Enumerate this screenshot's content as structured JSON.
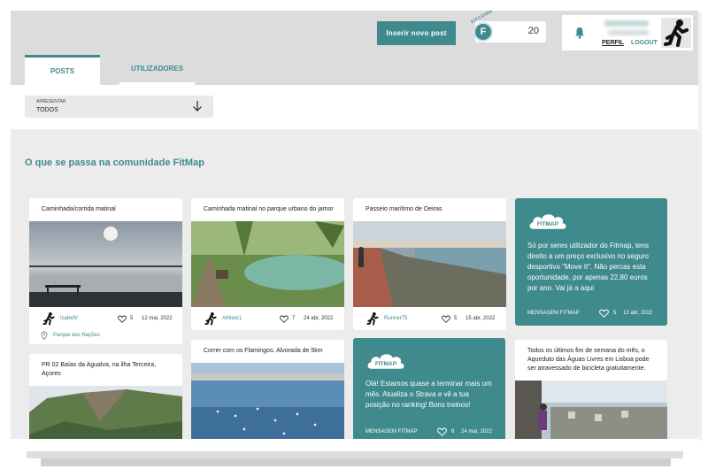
{
  "header": {
    "new_post_label": "Inserir novo post",
    "coins_label": "FITCOINS",
    "coin_letter": "F",
    "coins_value": "20",
    "profile_link": "PERFIL",
    "logout_link": "LOGOUT"
  },
  "tabs": [
    {
      "label": "POSTS",
      "active": true
    },
    {
      "label": "UTILIZADORES",
      "active": false
    }
  ],
  "filter": {
    "label": "APRESENTAR",
    "value": "TODOS"
  },
  "section_title": "O que se passa na comunidade FitMap",
  "posts": [
    {
      "title": "Caminhada/corrida matinal",
      "user": "IsabelV",
      "likes": "5",
      "date": "12 mai, 2022",
      "location": "Parque das Nações"
    },
    {
      "title": "Caminhada matinal no parque urbano do jamor",
      "user": "Athlete1",
      "likes": "7",
      "date": "24 abr, 2022"
    },
    {
      "title": "Passeio marítimo de Oeiras",
      "user": "Runner75",
      "likes": "5",
      "date": "15 abr, 2022"
    },
    {
      "title": "PR 02 Baías da Agualva, na ilha Terceira, Açores"
    },
    {
      "title": "Correr com os Flamingos. Alvorada de 5km"
    },
    {
      "title": "Todos os últimos fim de semana do mês, o Aqueduto das Águas Livres em Lisboa pode ser atravessado de bicicleta gratuitamente."
    }
  ],
  "messages": [
    {
      "text": "Só por seres utilizador do Fitmap, tens direito a um preço exclusivo no seguro desportivo \"Move It\". Não percas esta oportunidade, por apenas 22,80 euros por ano. Vai já a aqui",
      "label": "MENSAGEM FITMAP",
      "likes": "5",
      "date": "12 abr, 2022"
    },
    {
      "text": "Olá! Estamos quase a terminar mais um mês. Atualiza o Strava e vê a tua posição no ranking! Bons treinos!",
      "label": "MENSAGEM FITMAP",
      "likes": "6",
      "date": "24 mar, 2022"
    }
  ],
  "logo_text": "FITMAP",
  "colors": {
    "accent": "#3f8a8c",
    "background": "#ececec"
  }
}
